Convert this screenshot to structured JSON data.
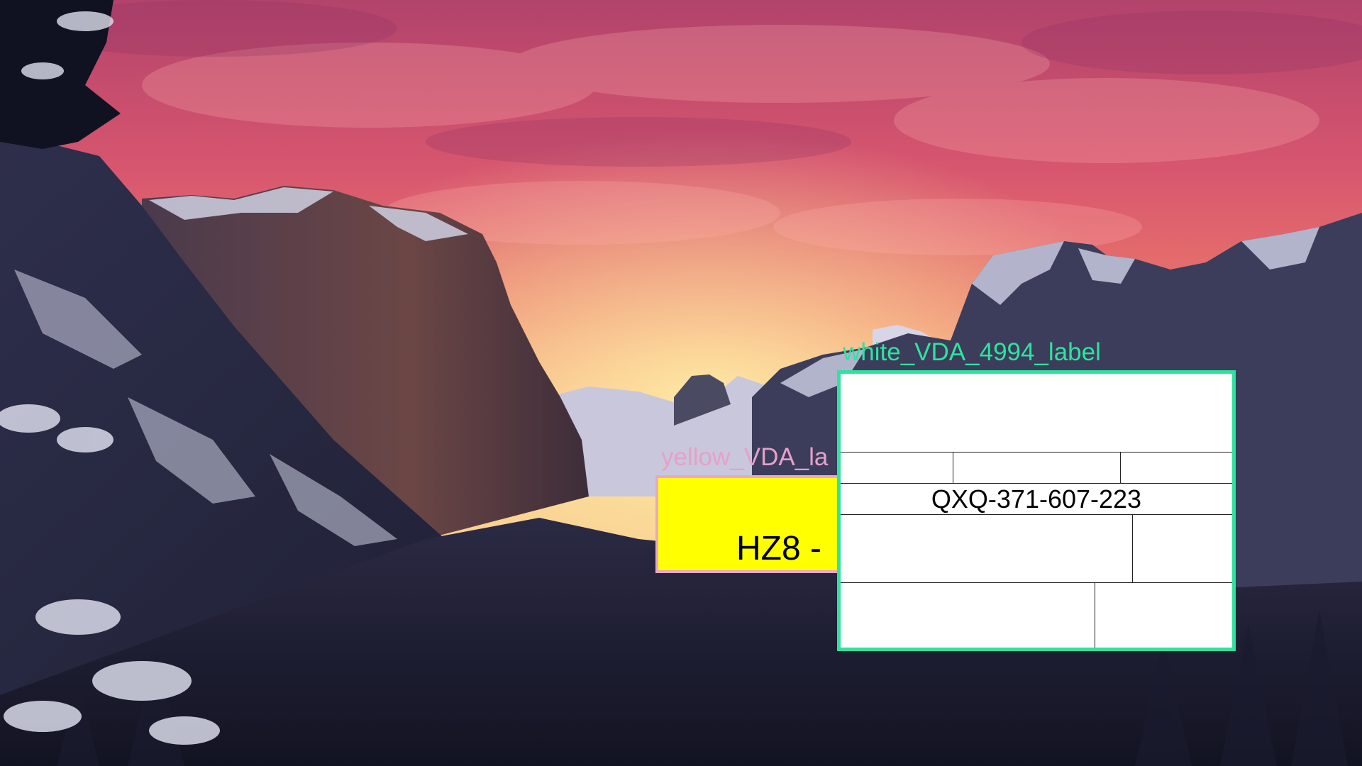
{
  "yellow_label": {
    "caption": "yellow_VDA_la",
    "text": "HZ8 - ",
    "background_color": "#ffff00",
    "border_color": "#e9a7cf"
  },
  "white_label": {
    "caption": "white_VDA_4994_label",
    "code": "QXQ-371-607-223",
    "background_color": "#ffffff",
    "border_color": "#2ee39e"
  }
}
